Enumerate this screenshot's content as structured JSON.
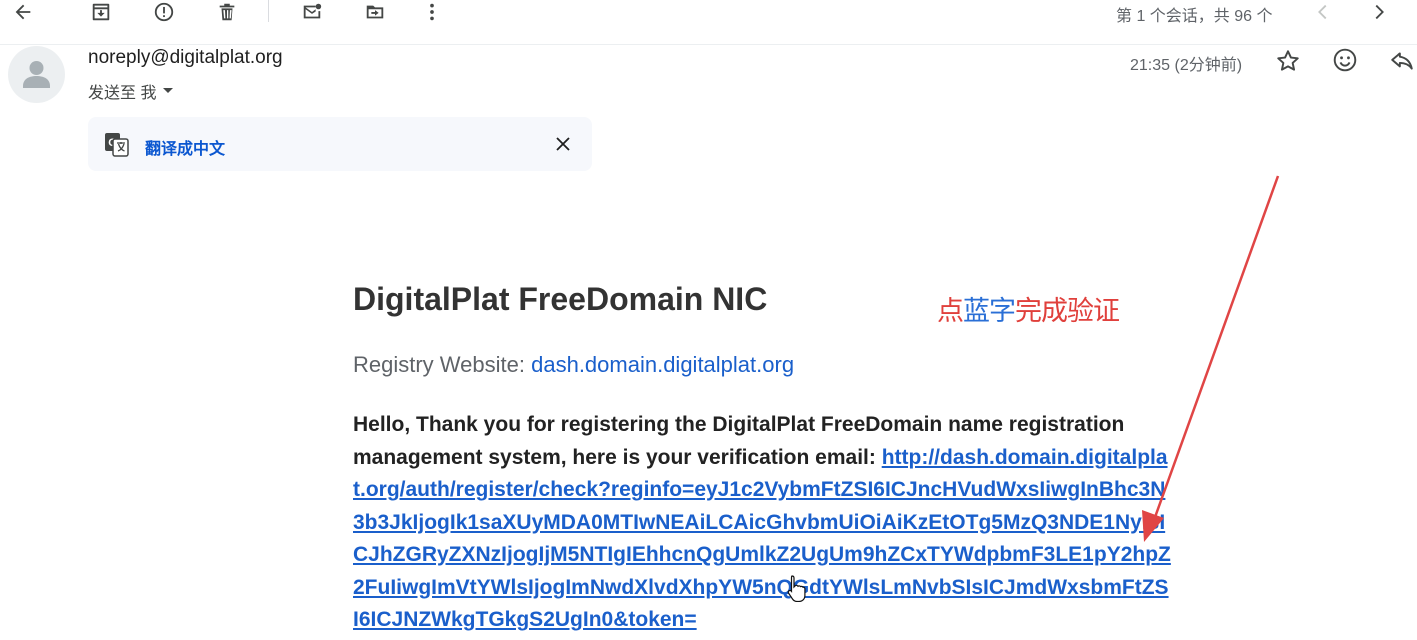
{
  "toolbar": {
    "buttons": [
      "back-icon",
      "archive-icon",
      "report-spam-icon",
      "delete-icon",
      "mark-unread-icon",
      "move-to-icon",
      "more-icon"
    ],
    "paging": "第 1 个会话，共 96 个"
  },
  "header": {
    "sender": "noreply@digitalplat.org",
    "send_to": "发送至 我",
    "time": "21:35 (2分钟前)"
  },
  "translate": {
    "label": "翻译成中文"
  },
  "email": {
    "title": "DigitalPlat FreeDomain NIC",
    "annotation_red1": "点",
    "annotation_blue": "蓝字",
    "annotation_red2": "完成验证",
    "registry_label": "Registry Website: ",
    "registry_link": "dash.domain.digitalplat.org",
    "body_text": "Hello, Thank you for registering the DigitalPlat FreeDomain name registration management system, here is your verification email: ",
    "verification_link": "http://dash.domain.digitalplat.org/auth/register/check?reginfo=eyJ1c2VybmFtZSI6ICJncHVudWxsIiwgInBhc3N3b3JkIjogIk1saXUyMDA0MTIwNEAiLCAicGhvbmUiOiAiKzEtOTg5MzQ3NDE1NyIsICJhZGRyZXNzIjogIjM5NTIgIEhhcnQgUmlkZ2UgUm9hZCxTYWdpbmF3LE1pY2hpZ2FuIiwgImVtYWlsIjogImNwdXlvdXhpYW5nQGdtYWlsLmNvbSIsICJmdWxsbmFtZSI6ICJNZWkgTGkgS2UgIn0&token="
  },
  "colors": {
    "link": "#1a5fcb",
    "annotation_red": "#e0403c",
    "annotation_blue": "#2a6fd6",
    "arrow": "#e04545"
  }
}
